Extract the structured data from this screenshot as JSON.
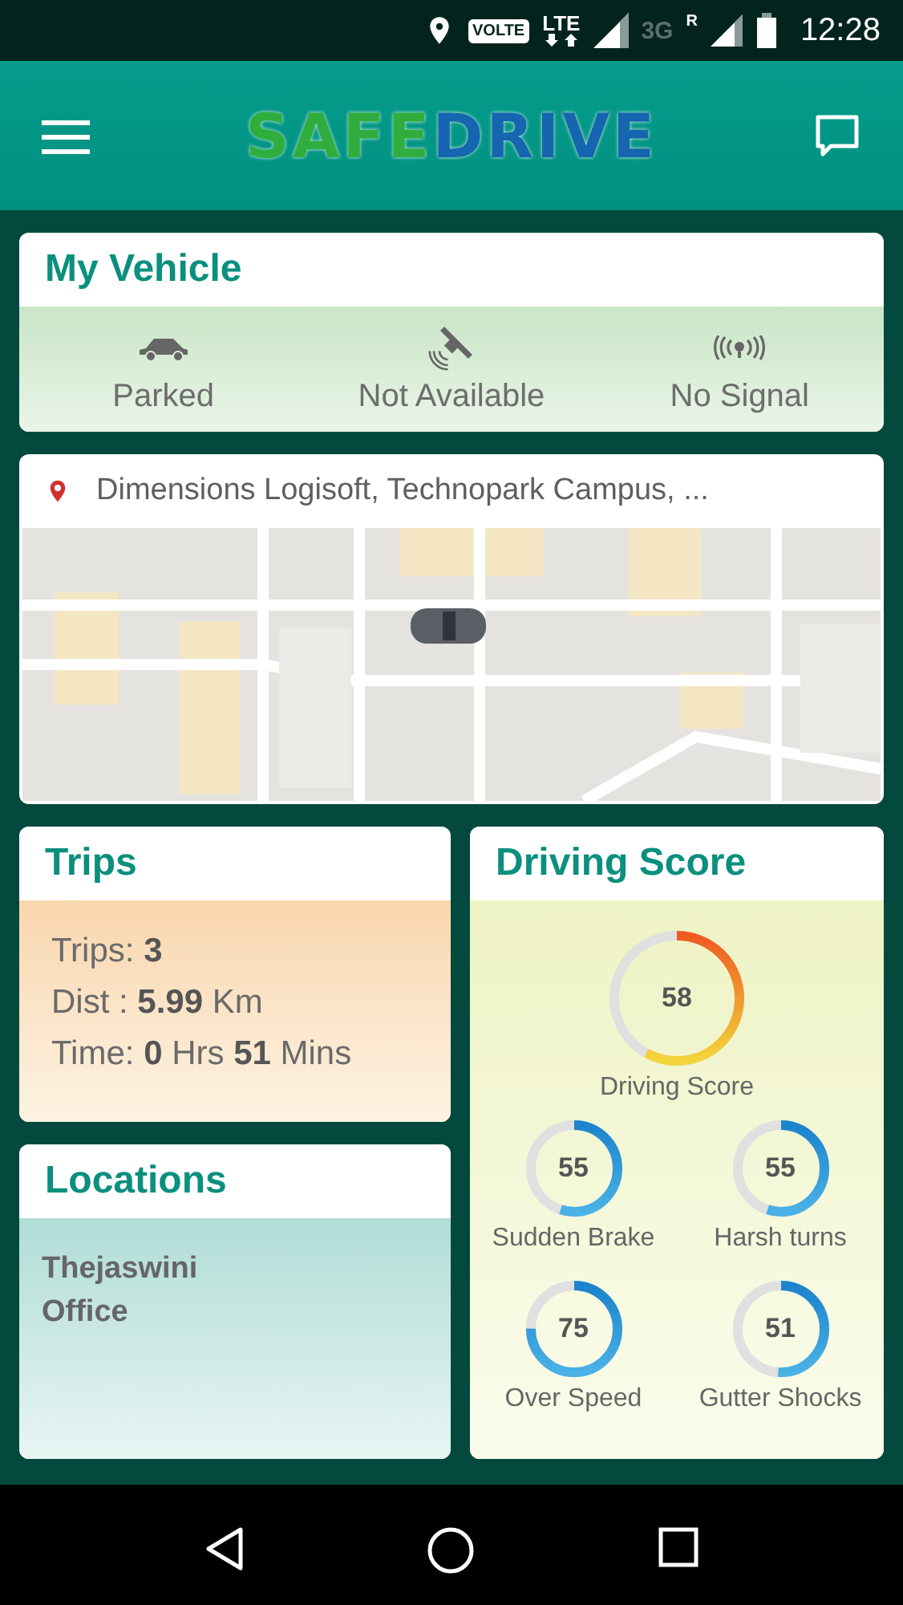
{
  "status_bar": {
    "network_badge": "VOLTE",
    "network_type": "LTE",
    "secondary_network": "3G",
    "roaming": "R",
    "time": "12:28"
  },
  "app_bar": {
    "logo": [
      "SAFE",
      "DRIVE"
    ]
  },
  "my_vehicle": {
    "title": "My Vehicle",
    "statuses": [
      {
        "kind": "car",
        "label": "Parked"
      },
      {
        "kind": "satellite",
        "label": "Not Available"
      },
      {
        "kind": "signal",
        "label": "No Signal"
      }
    ]
  },
  "location_card": {
    "address": "Dimensions Logisoft, Technopark Campus, ..."
  },
  "trips": {
    "title": "Trips",
    "lines": [
      "Trips: **3**",
      "Dist : **5.99** Km",
      "Time: **0** Hrs **51** Mins"
    ]
  },
  "locations": {
    "title": "Locations",
    "items": [
      "Thejaswini Office"
    ]
  },
  "driving_score": {
    "title": "Driving Score",
    "main": {
      "value": "58",
      "label": "Driving Score",
      "level": 0.58
    },
    "metrics": [
      {
        "value": "55",
        "label": "Sudden Brake",
        "level": 0.55
      },
      {
        "value": "55",
        "label": "Harsh turns",
        "level": 0.55
      },
      {
        "value": "75",
        "label": "Over Speed",
        "level": 0.75
      },
      {
        "value": "51",
        "label": "Gutter Shocks",
        "level": 0.51
      }
    ]
  }
}
